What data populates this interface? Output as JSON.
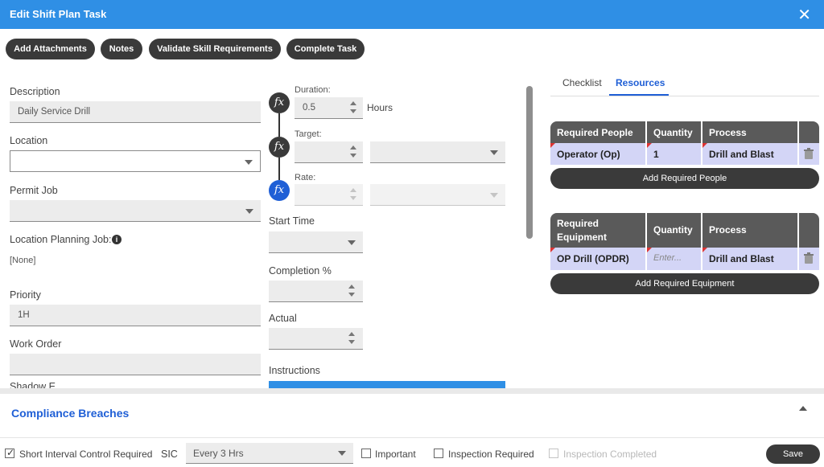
{
  "dialog": {
    "title": "Edit Shift Plan Task",
    "close_icon": "close-icon"
  },
  "toolbar": {
    "add_attachments": "Add Attachments",
    "notes": "Notes",
    "validate_skill": "Validate Skill Requirements",
    "complete_task": "Complete Task"
  },
  "left": {
    "description_label": "Description",
    "description_value": "Daily Service Drill",
    "location_label": "Location",
    "location_value": "",
    "permit_job_label": "Permit Job",
    "permit_job_value": "",
    "location_planning_job_label": "Location Planning Job:",
    "location_planning_job_value": "[None]",
    "priority_label": "Priority",
    "priority_value": "1H",
    "work_order_label": "Work Order",
    "work_order_value": "",
    "clipped_label": "Shadow E..."
  },
  "middle": {
    "duration_label": "Duration:",
    "duration_value": "0.5",
    "duration_unit": "Hours",
    "target_label": "Target:",
    "rate_label": "Rate:",
    "start_time_label": "Start Time",
    "completion_label": "Completion %",
    "actual_label": "Actual",
    "instructions_label": "Instructions"
  },
  "tabs": {
    "checklist": "Checklist",
    "resources": "Resources",
    "active": "Resources"
  },
  "people": {
    "headers": [
      "Required People",
      "Quantity",
      "Process"
    ],
    "rows": [
      {
        "name": "Operator (Op)",
        "quantity": "1",
        "process": "Drill and Blast"
      }
    ],
    "add_label": "Add Required People"
  },
  "equipment": {
    "headers": [
      "Required Equipment",
      "Quantity",
      "Process"
    ],
    "rows": [
      {
        "name": "OP Drill (OPDR)",
        "quantity_placeholder": "Enter...",
        "process": "Drill and Blast"
      }
    ],
    "add_label": "Add Required Equipment"
  },
  "compliance": {
    "title": "Compliance Breaches"
  },
  "footer": {
    "sic_required_label": "Short Interval Control Required",
    "sic_required_checked": true,
    "sic_label": "SIC",
    "sic_value": "Every 3 Hrs",
    "important_label": "Important",
    "inspection_required_label": "Inspection Required",
    "inspection_completed_label": "Inspection Completed",
    "save_label": "Save"
  },
  "colors": {
    "title_bar": "#2f8fe5",
    "accent_blue": "#1f5fd6",
    "dark_button": "#3a3a3a",
    "table_header": "#5a5a5a",
    "table_row": "#d3d5f6"
  }
}
